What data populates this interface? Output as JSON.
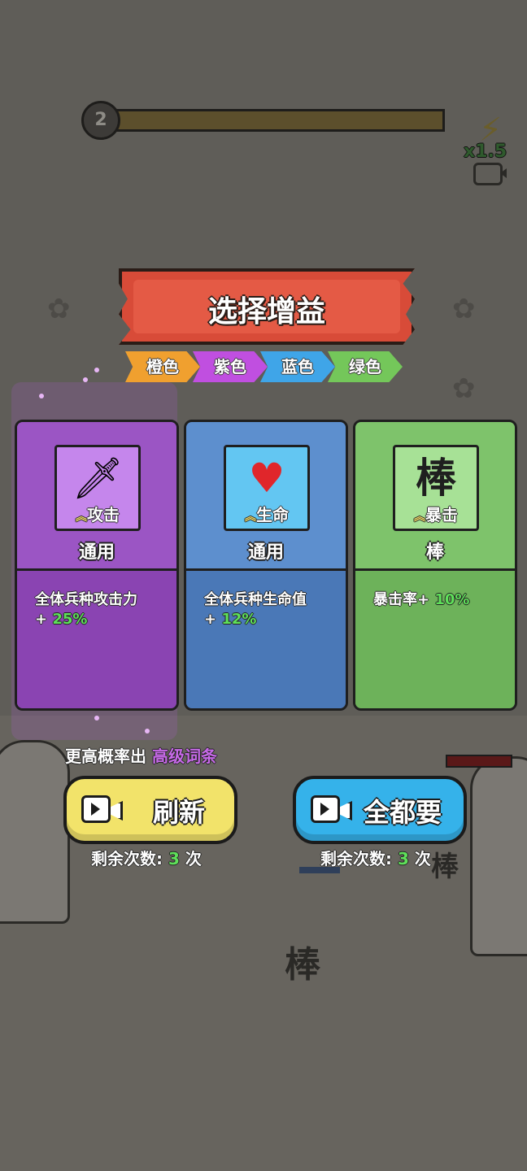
{
  "hud": {
    "level": "2",
    "level_progress": 0.0,
    "speed": "x1.5",
    "speed_icon": "lightning-bolt-icon"
  },
  "title": "选择增益",
  "rarity_tags": [
    {
      "label": "橙色",
      "color": "#f0a02f"
    },
    {
      "label": "紫色",
      "color": "#c04fe0"
    },
    {
      "label": "蓝色",
      "color": "#3fa5e8"
    },
    {
      "label": "绿色",
      "color": "#74c75a"
    }
  ],
  "cards": [
    {
      "rarity": "purple",
      "icon": "sword-icon",
      "icon_label": "攻击",
      "category": "通用",
      "desc": "全体兵种攻击力",
      "value_prefix": "+ ",
      "value": "25%",
      "colors": {
        "top": "#9b55c4",
        "bottom": "#8a44b2",
        "icon_bg": "#c586ec"
      }
    },
    {
      "rarity": "blue",
      "icon": "heart-icon",
      "icon_label": "生命",
      "category": "通用",
      "desc": "全体兵种生命值",
      "value_prefix": "+ ",
      "value": "12%",
      "colors": {
        "top": "#5d8fce",
        "bottom": "#4a78b7",
        "icon_bg": "#63c6f2"
      }
    },
    {
      "rarity": "green",
      "icon": "stick-unit-icon",
      "icon_label": "暴击",
      "category": "棒",
      "desc": "暴击率+ ",
      "value_prefix": "",
      "value": "10%",
      "colors": {
        "top": "#7ec36b",
        "bottom": "#6db25a",
        "icon_bg": "#a7e196"
      }
    }
  ],
  "chance_text": "更高概率出 ",
  "chance_highlight": "高级词条",
  "buttons": {
    "refresh": {
      "label": "刷新",
      "remain_label": "剩余次数: ",
      "remain_count": "3",
      "remain_suffix": " 次",
      "color": "#f2e36a"
    },
    "take_all": {
      "label": "全都要",
      "remain_label": "剩余次数: ",
      "remain_count": "3",
      "remain_suffix": " 次",
      "color": "#35b2ea"
    }
  },
  "battlefield": {
    "unit_glyph": "棒",
    "unit_glyph_2": "棒"
  }
}
